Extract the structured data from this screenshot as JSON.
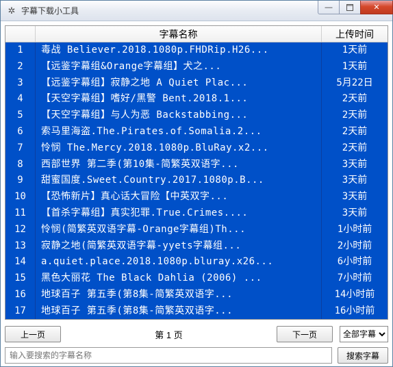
{
  "window": {
    "title": "字幕下载小工具",
    "icon": "gear-icon",
    "min_label": "—",
    "close_label": "✕"
  },
  "table": {
    "headers": {
      "index": "",
      "name": "字幕名称",
      "time": "上传时间"
    },
    "rows": [
      {
        "idx": "1",
        "name": "毒战 Believer.2018.1080p.FHDRip.H26...",
        "time": "1天前"
      },
      {
        "idx": "2",
        "name": "【远鉴字幕组&amp;Orange字幕组】犬之...",
        "time": "1天前"
      },
      {
        "idx": "3",
        "name": "【远鉴字幕组】寂静之地 A Quiet Plac...",
        "time": "5月22日"
      },
      {
        "idx": "4",
        "name": "【天空字幕组】嗜好/黑警 Bent.2018.1...",
        "time": "2天前"
      },
      {
        "idx": "5",
        "name": "【天空字幕组】与人为恶 Backstabbing...",
        "time": "2天前"
      },
      {
        "idx": "6",
        "name": "索马里海盗.The.Pirates.of.Somalia.2...",
        "time": "2天前"
      },
      {
        "idx": "7",
        "name": "怜悯 The.Mercy.2018.1080p.BluRay.x2...",
        "time": "2天前"
      },
      {
        "idx": "8",
        "name": "西部世界 第二季(第10集-简繁英双语字...",
        "time": "3天前"
      },
      {
        "idx": "9",
        "name": "甜蜜国度.Sweet.Country.2017.1080p.B...",
        "time": "3天前"
      },
      {
        "idx": "10",
        "name": "【恐怖新片】真心话大冒险【中英双字...",
        "time": "3天前"
      },
      {
        "idx": "11",
        "name": "【首杀字幕组】真实犯罪.True.Crimes....",
        "time": "3天前"
      },
      {
        "idx": "12",
        "name": "怜悯(简繁英双语字幕-Orange字幕组)Th...",
        "time": "1小时前"
      },
      {
        "idx": "13",
        "name": "寂静之地(简繁英双语字幕-yyets字幕组...",
        "time": "2小时前"
      },
      {
        "idx": "14",
        "name": "a.quiet.place.2018.1080p.bluray.x26...",
        "time": "6小时前"
      },
      {
        "idx": "15",
        "name": "黑色大丽花 The Black Dahlia (2006) ...",
        "time": "7小时前"
      },
      {
        "idx": "16",
        "name": "地球百子 第五季(第8集-简繁英双语字...",
        "time": "14小时前"
      },
      {
        "idx": "17",
        "name": "地球百子 第五季(第8集-简繁英双语字...",
        "time": "16小时前"
      }
    ]
  },
  "pager": {
    "prev": "上一页",
    "label": "第 1 页",
    "next": "下一页",
    "filter_selected": "全部字幕"
  },
  "search": {
    "placeholder": "输入要搜索的字幕名称",
    "button": "搜索字幕"
  }
}
